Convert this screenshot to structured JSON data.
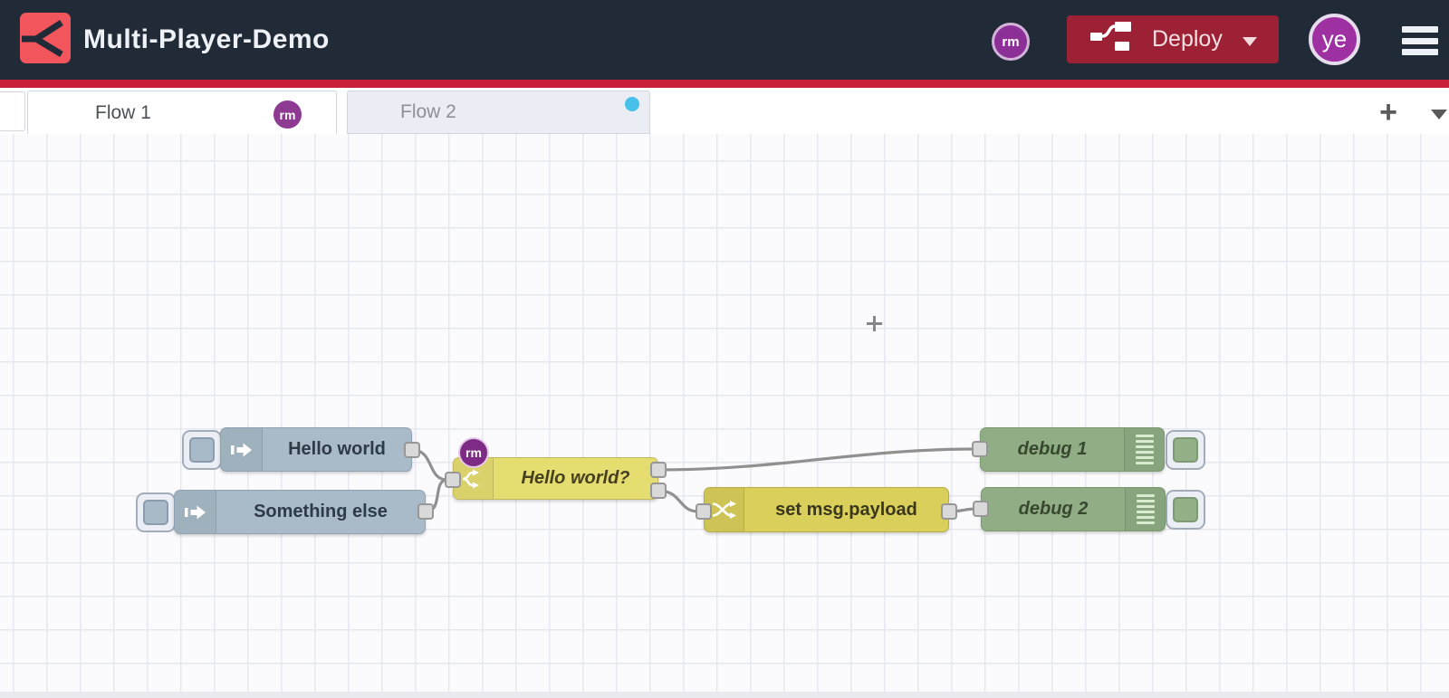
{
  "header": {
    "title": "Multi-Player-Demo",
    "collaborator_badge": "rm",
    "deploy": {
      "label": "Deploy"
    },
    "user_avatar": "ye"
  },
  "tab_bar": {
    "tabs": [
      {
        "label": "Flow 1",
        "active": true,
        "badge": "rm"
      },
      {
        "label": "Flow 2",
        "active": false,
        "unsaved_indicator": true
      }
    ],
    "add_button": "+"
  },
  "flow": {
    "nodes": [
      {
        "type": "inject",
        "label": "Hello world"
      },
      {
        "type": "inject",
        "label": "Something else"
      },
      {
        "type": "switch",
        "label": "Hello world?",
        "badge": "rm",
        "outputs": 2
      },
      {
        "type": "change",
        "label": "set msg.payload"
      },
      {
        "type": "debug",
        "label": "debug 1"
      },
      {
        "type": "debug",
        "label": "debug 2"
      }
    ],
    "wires": [
      {
        "from": "Hello world",
        "to": "Hello world?"
      },
      {
        "from": "Something else",
        "to": "Hello world?"
      },
      {
        "from": "Hello world? (output 1)",
        "to": "debug 1"
      },
      {
        "from": "Hello world? (output 2)",
        "to": "set msg.payload"
      },
      {
        "from": "set msg.payload",
        "to": "debug 2"
      }
    ]
  },
  "colors": {
    "header_bg": "#212b38",
    "brand_red": "#f2555c",
    "accent_red_line": "#c72038",
    "deploy_button_red": "#9d2134",
    "avatar_purple": "#9e30a2",
    "badge_purple": "#8c2f96",
    "inject_node": "#a9bbc9",
    "switch_node": "#e6dd71",
    "change_node": "#d9cf5a",
    "debug_node": "#90ad85",
    "inactive_tab": "#eaedf4",
    "unsaved_dot_blue": "#47c0ea",
    "wire_gray": "#909090"
  }
}
